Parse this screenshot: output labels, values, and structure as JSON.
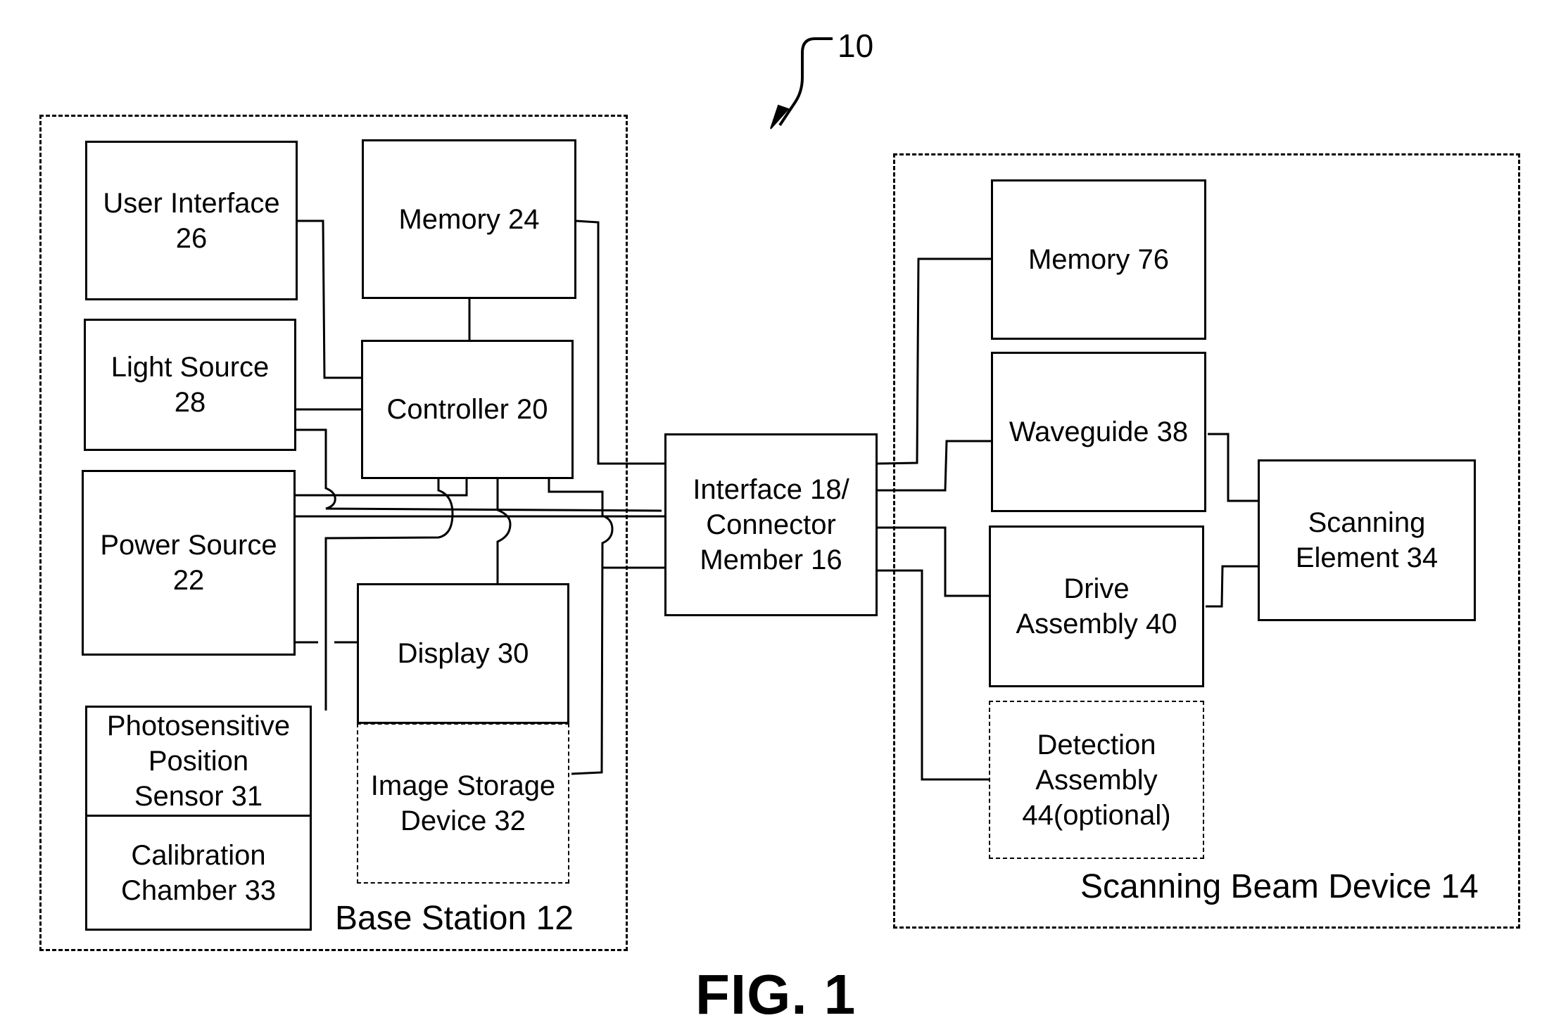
{
  "figure": {
    "reference_number": "10",
    "caption": "FIG. 1"
  },
  "base_station": {
    "label": "Base Station 12",
    "blocks": {
      "user_interface": "User Interface\n26",
      "memory": "Memory 24",
      "light_source": "Light Source\n28",
      "controller": "Controller 20",
      "power_source": "Power Source\n22",
      "display": "Display 30",
      "position_sensor": "Photosensitive\nPosition\nSensor 31",
      "calibration_chamber": "Calibration\nChamber 33",
      "image_storage": "Image Storage\nDevice 32"
    }
  },
  "interface": {
    "label": "Interface 18/\nConnector\nMember 16"
  },
  "scanning_beam_device": {
    "label": "Scanning Beam Device 14",
    "blocks": {
      "memory": "Memory 76",
      "waveguide": "Waveguide 38",
      "drive_assembly": "Drive\nAssembly 40",
      "detection_assembly": "Detection\nAssembly\n44(optional)",
      "scanning_element": "Scanning\nElement 34"
    }
  }
}
